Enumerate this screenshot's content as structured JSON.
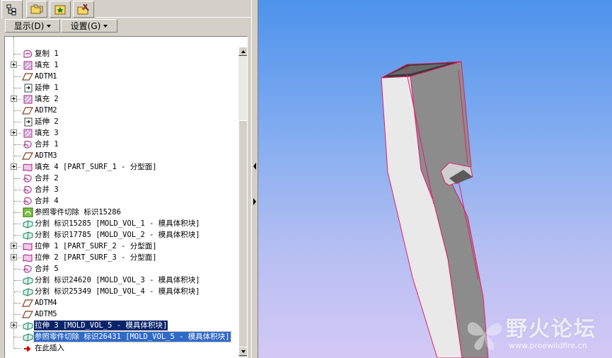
{
  "tabs": [
    {
      "name": "model-tree-tab",
      "icon": "model-tree-icon"
    },
    {
      "name": "folder-browser-tab",
      "icon": "folder-icon"
    },
    {
      "name": "favorites-tab",
      "icon": "favorites-icon"
    },
    {
      "name": "connections-tab",
      "icon": "tools-icon"
    }
  ],
  "menu": {
    "show_label": "显示(D)",
    "settings_label": "设置(G)"
  },
  "tree": [
    {
      "label": "复制 1",
      "icon": "copy-surface-icon",
      "expandable": false,
      "state": ""
    },
    {
      "label": "填充 1",
      "icon": "fill-icon",
      "expandable": true,
      "state": ""
    },
    {
      "label": "ADTM1",
      "icon": "datum-plane-icon",
      "expandable": false,
      "state": ""
    },
    {
      "label": "延伸 1",
      "icon": "extend-icon",
      "expandable": false,
      "state": ""
    },
    {
      "label": "填充 2",
      "icon": "fill-icon",
      "expandable": true,
      "state": ""
    },
    {
      "label": "ADTM2",
      "icon": "datum-plane-icon",
      "expandable": false,
      "state": ""
    },
    {
      "label": "延伸 2",
      "icon": "extend-icon",
      "expandable": false,
      "state": ""
    },
    {
      "label": "填充 3",
      "icon": "fill-icon",
      "expandable": true,
      "state": ""
    },
    {
      "label": "合并 1",
      "icon": "merge-icon",
      "expandable": false,
      "state": ""
    },
    {
      "label": "ADTM3",
      "icon": "datum-plane-icon",
      "expandable": false,
      "state": ""
    },
    {
      "label": "填充 4 [PART_SURF_1 - 分型面]",
      "icon": "parting-surface-icon",
      "expandable": true,
      "state": ""
    },
    {
      "label": "合并 2",
      "icon": "merge-icon",
      "expandable": false,
      "state": ""
    },
    {
      "label": "合并 3",
      "icon": "merge-icon",
      "expandable": false,
      "state": ""
    },
    {
      "label": "合并 4",
      "icon": "merge-icon",
      "expandable": false,
      "state": ""
    },
    {
      "label": "参照零件切除 标识15286",
      "icon": "reference-cut-icon",
      "expandable": false,
      "state": ""
    },
    {
      "label": "分割 标识15285 [MOLD_VOL_1 - 模具体积块]",
      "icon": "split-icon",
      "expandable": false,
      "state": ""
    },
    {
      "label": "分割 标识17785 [MOLD_VOL_2 - 模具体积块]",
      "icon": "split-icon",
      "expandable": false,
      "state": ""
    },
    {
      "label": "拉伸 1 [PART_SURF_2 - 分型面]",
      "icon": "parting-surface-icon",
      "expandable": true,
      "state": ""
    },
    {
      "label": "拉伸 2 [PART_SURF_3 - 分型面]",
      "icon": "parting-surface-icon",
      "expandable": true,
      "state": ""
    },
    {
      "label": "合并 5",
      "icon": "merge-icon",
      "expandable": false,
      "state": ""
    },
    {
      "label": "分割 标识24620 [MOLD_VOL_3 - 模具体积块]",
      "icon": "split-icon",
      "expandable": false,
      "state": ""
    },
    {
      "label": "分割 标识25349 [MOLD_VOL_4 - 模具体积块]",
      "icon": "split-icon",
      "expandable": false,
      "state": ""
    },
    {
      "label": "ADTM4",
      "icon": "datum-plane-icon",
      "expandable": false,
      "state": ""
    },
    {
      "label": "ADTM5",
      "icon": "datum-plane-icon",
      "expandable": false,
      "state": ""
    },
    {
      "label": "拉伸 3 [MOLD_VOL_5 - 模具体积块]",
      "icon": "split-icon",
      "expandable": true,
      "state": "selected"
    },
    {
      "label": "参照零件切除 标识26431 [MOLD_VOL_5 - 模具体积块]",
      "icon": "split-icon",
      "expandable": false,
      "state": "highlighted"
    },
    {
      "label": "在此插入",
      "icon": "insert-here-arrow-icon",
      "expandable": false,
      "state": ""
    }
  ],
  "colors": {
    "selection": "#0a246a",
    "highlight": "#316ac5",
    "model_edge": "#e0206a",
    "model_face_light": "#e8e8e8",
    "model_face_dark": "#8a8a8a"
  },
  "watermark": {
    "title": "野火论坛",
    "url": "www.proewildfire.cn"
  }
}
